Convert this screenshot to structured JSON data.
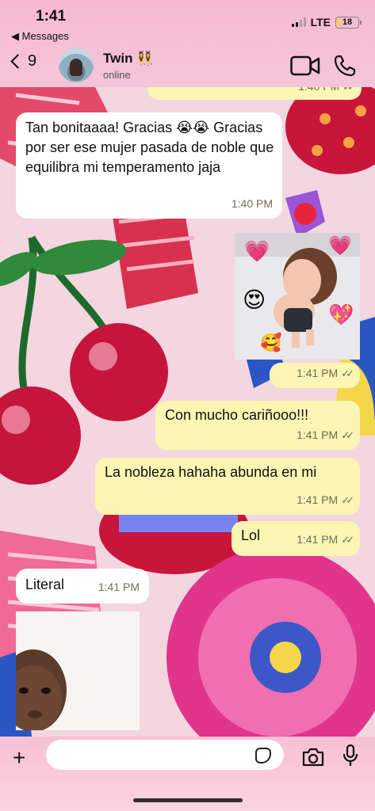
{
  "status_bar": {
    "time": "1:41",
    "back_app": "◀ Messages",
    "network": "LTE",
    "battery": "18",
    "battery_level": 0.18
  },
  "header": {
    "back_count": "9",
    "contact_name": "Twin 👯‍♀️",
    "contact_status": "online"
  },
  "messages": [
    {
      "dir": "out",
      "text": "",
      "time": "1:40 PM",
      "partial": true
    },
    {
      "dir": "in",
      "text": "Tan bonitaaaa! Gracias 😭😭 Gracias por ser ese mujer pasada de noble que equilibra mi temperamento jaja",
      "time": "1:40 PM"
    },
    {
      "dir": "out",
      "type": "photo",
      "time": "1:41 PM",
      "emojis": [
        "💗",
        "💗",
        "😍",
        "💖",
        "🥰"
      ]
    },
    {
      "dir": "out",
      "text": "Con mucho cariñooo!!!",
      "time": "1:41 PM"
    },
    {
      "dir": "out",
      "text": "La nobleza hahaha abunda en mi",
      "time": "1:41 PM"
    },
    {
      "dir": "out",
      "text": "Lol",
      "time": "1:41 PM"
    },
    {
      "dir": "in",
      "text": "Literal",
      "time": "1:41 PM"
    },
    {
      "dir": "in",
      "type": "photo"
    }
  ],
  "composer": {
    "placeholder": ""
  },
  "icons": [
    "back-chevron-icon",
    "video-call-icon",
    "phone-icon",
    "plus-icon",
    "sticker-icon",
    "camera-icon",
    "microphone-icon",
    "double-check-icon"
  ],
  "colors": {
    "incoming_bubble": "#ffffff",
    "outgoing_bubble": "#fbf6b3",
    "bar_pink": "#f7b9d1"
  }
}
